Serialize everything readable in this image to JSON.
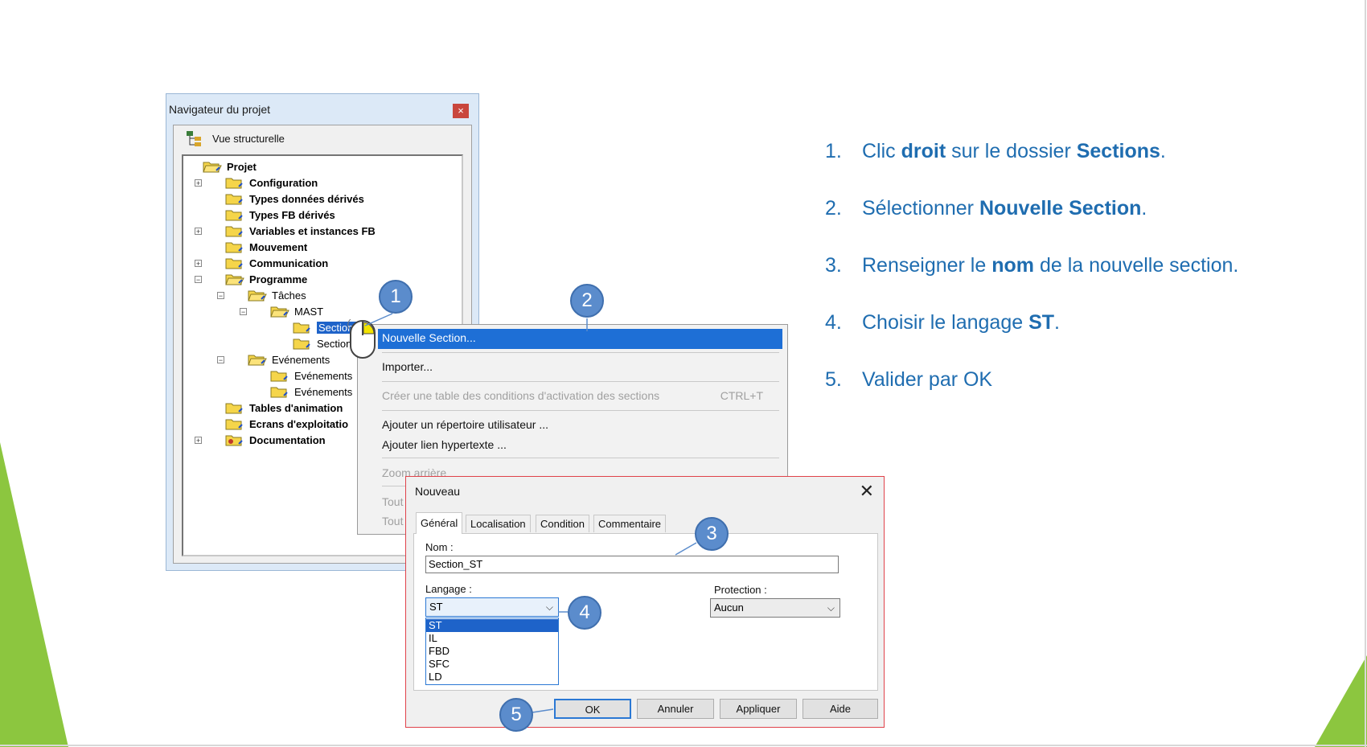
{
  "navigator": {
    "title": "Navigateur du projet",
    "close_label": "×",
    "view_label": "Vue structurelle",
    "tree": [
      {
        "label": "Projet"
      },
      {
        "label": "Configuration",
        "expander": "+"
      },
      {
        "label": "Types données dérivés"
      },
      {
        "label": "Types FB dérivés"
      },
      {
        "label": "Variables et instances FB",
        "expander": "+"
      },
      {
        "label": "Mouvement"
      },
      {
        "label": "Communication",
        "expander": "+"
      },
      {
        "label": "Programme",
        "expander": "−"
      },
      {
        "label": "Tâches",
        "expander": "−"
      },
      {
        "label": "MAST",
        "expander": "−"
      },
      {
        "label": "Sections"
      },
      {
        "label": "Section"
      },
      {
        "label": "Evénements",
        "expander": "−"
      },
      {
        "label": "Evénements"
      },
      {
        "label": "Evénements"
      },
      {
        "label": "Tables d'animation"
      },
      {
        "label": "Ecrans d'exploitatio"
      },
      {
        "label": "Documentation",
        "expander": "+"
      }
    ]
  },
  "context_menu": {
    "items": [
      {
        "label": "Nouvelle Section...",
        "state": "highlighted"
      },
      {
        "label": "Importer..."
      },
      {
        "label": "Créer une table des conditions d'activation des sections",
        "state": "disabled",
        "shortcut": "CTRL+T"
      },
      {
        "label": "Ajouter un répertoire utilisateur ..."
      },
      {
        "label": "Ajouter lien hypertexte ..."
      },
      {
        "label": "Zoom arrière",
        "state": "disabled"
      },
      {
        "label": "Tout",
        "state": "disabled"
      },
      {
        "label": "Tout",
        "state": "disabled"
      }
    ]
  },
  "dialog": {
    "title": "Nouveau",
    "close_label": "✕",
    "tabs": [
      "Général",
      "Localisation",
      "Condition",
      "Commentaire"
    ],
    "active_tab": "Général",
    "name_label": "Nom :",
    "name_value": "Section_ST",
    "language_label": "Langage :",
    "language_value": "ST",
    "language_options": [
      "ST",
      "IL",
      "FBD",
      "SFC",
      "LD"
    ],
    "protection_label": "Protection :",
    "protection_value": "Aucun",
    "buttons": {
      "ok": "OK",
      "cancel": "Annuler",
      "apply": "Appliquer",
      "help": "Aide"
    }
  },
  "callouts": [
    "1",
    "2",
    "3",
    "4",
    "5"
  ],
  "instructions": [
    {
      "num": "1.",
      "parts": [
        [
          "Clic ",
          false
        ],
        [
          "droit",
          true
        ],
        [
          " sur le dossier ",
          false
        ],
        [
          "Sections",
          true
        ],
        [
          ".",
          false
        ]
      ]
    },
    {
      "num": "2.",
      "parts": [
        [
          "Sélectionner ",
          false
        ],
        [
          "Nouvelle Section",
          true
        ],
        [
          ".",
          false
        ]
      ]
    },
    {
      "num": "3.",
      "parts": [
        [
          "Renseigner le ",
          false
        ],
        [
          "nom",
          true
        ],
        [
          " de la nouvelle section.",
          false
        ]
      ]
    },
    {
      "num": "4.",
      "parts": [
        [
          "Choisir le langage ",
          false
        ],
        [
          "ST",
          true
        ],
        [
          ".",
          false
        ]
      ]
    },
    {
      "num": "5.",
      "parts": [
        [
          "Valider par OK",
          false
        ]
      ]
    }
  ],
  "colors": {
    "accent_green": "#8cc63f",
    "instruction_blue": "#1f6db0",
    "callout_blue": "#5b8ccc",
    "selection_blue": "#1e63c9"
  }
}
